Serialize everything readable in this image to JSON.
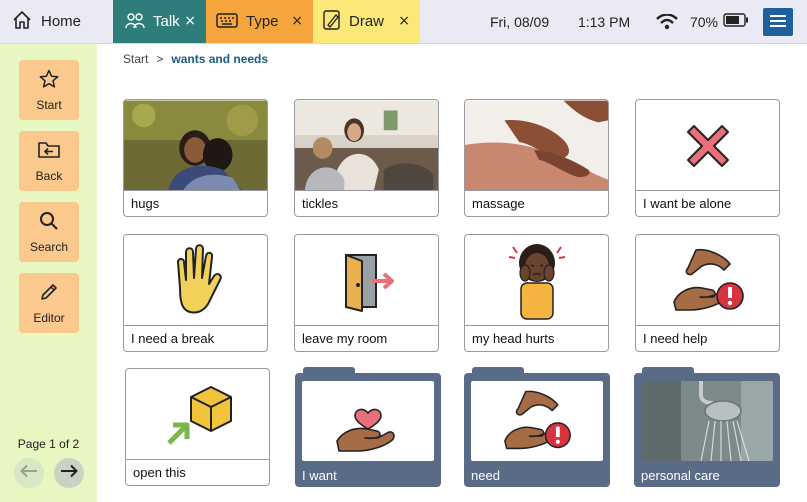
{
  "tabs": {
    "home": "Home",
    "talk": "Talk",
    "type": "Type",
    "draw": "Draw",
    "close_glyph": "×"
  },
  "status": {
    "date": "Fri, 08/09",
    "time": "1:13 PM",
    "battery": "70%"
  },
  "sidebar": {
    "start": "Start",
    "back": "Back",
    "search": "Search",
    "editor": "Editor",
    "page_info": "Page 1 of 2"
  },
  "breadcrumb": {
    "root": "Start",
    "sep": ">",
    "current": "wants and needs"
  },
  "tiles": {
    "hugs": "hugs",
    "tickles": "tickles",
    "massage": "massage",
    "alone": "I want be alone",
    "break": "I need a break",
    "room": "leave my room",
    "head": "my head hurts",
    "help": "I need help",
    "open": "open this"
  },
  "folders": {
    "want": "I want",
    "need": "need",
    "care": "personal care"
  },
  "colors": {
    "talk_tab": "#2f7d7b",
    "type_tab": "#f6a43c",
    "draw_tab": "#fbe879",
    "sidebar_bg": "#e8f7c1",
    "sidebar_button": "#fbc88e",
    "folder": "#596b86",
    "menu_button": "#1f5f9e",
    "breadcrumb_current": "#1d5b80"
  }
}
